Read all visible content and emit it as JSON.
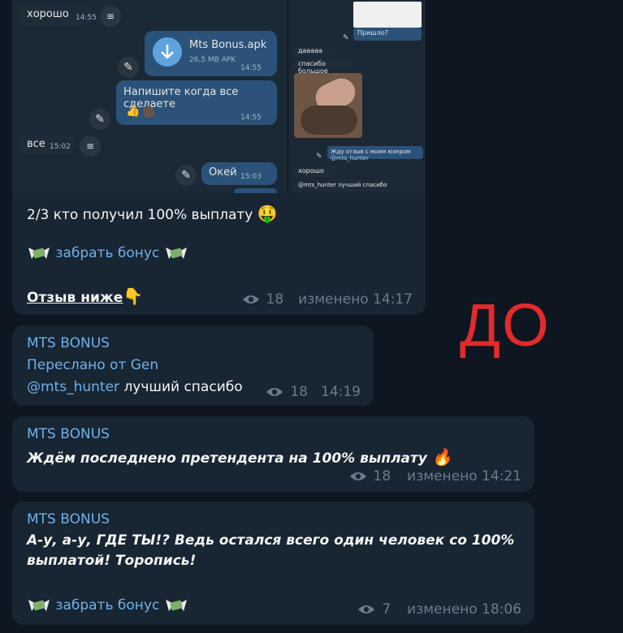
{
  "screenshot": {
    "left": {
      "msg1_text": "хорошо",
      "msg1_time": "14:55",
      "file_name": "Mts Bonus.apk",
      "file_size": "26,5 MB APK",
      "file_time": "14:55",
      "msg2_text": "Напишите когда все сделаете",
      "msg2_emoji": "👍",
      "msg2_time": "14:55",
      "msg3_text": "все",
      "msg3_time": "15:02",
      "msg4_text": "Окей",
      "msg4_time": "15:03"
    },
    "right": {
      "top_text": "Пришло?",
      "m1": "дааааа",
      "m2": "спасибо большое",
      "m3": "Жду отзыв с моим юзером",
      "m3_mention": "@mts_hunter",
      "m4": "хорошо",
      "m5_mention": "@mts_hunter",
      "m5_text": "лучший спасибо"
    }
  },
  "posts": [
    {
      "line1": "2/3 кто получил 100% выплату",
      "line1_emoji": "🤑",
      "bonus_link": "забрать бонус",
      "review": "Отзыв ниже",
      "review_emoji": "👇",
      "views": "18",
      "edited": "изменено 14:17"
    },
    {
      "author": "MTS BONUS",
      "forwarded": "Переслано от Gen",
      "mention": "@mts_hunter",
      "text": "лучший спасибо",
      "views": "18",
      "time": "14:19"
    },
    {
      "author": "MTS BONUS",
      "text": "Ждём последнено претендента на 100% выплату",
      "emoji": "🔥",
      "views": "18",
      "edited": "изменено 14:21"
    },
    {
      "author": "MTS BONUS",
      "text_line1": "А-у, а-у, ГДЕ ТЫ!? Ведь остался всего один человек со 100%",
      "text_line2": "выплатой! Торопись!",
      "bonus_link": "забрать бонус",
      "views": "7",
      "edited": "изменено 18:06"
    }
  ],
  "overlay_label": "ДО",
  "colors": {
    "background": "#0e1621",
    "bubble": "#182533",
    "accent": "#6fb1e8",
    "label": "#e32b2b"
  }
}
